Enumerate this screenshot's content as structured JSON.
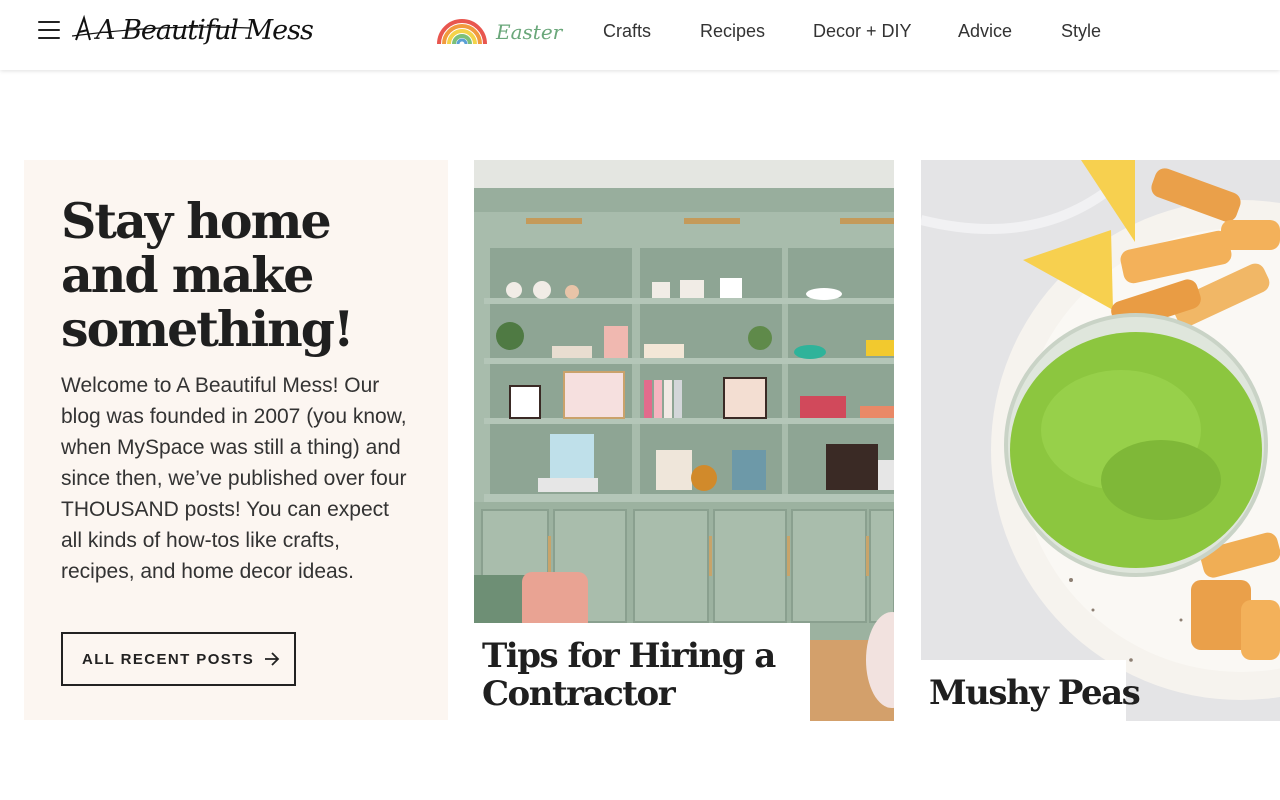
{
  "header": {
    "logo_text": "A Beautiful Mess",
    "promo_label": "Easter",
    "nav": [
      "Crafts",
      "Recipes",
      "Decor + DIY",
      "Advice",
      "Style"
    ]
  },
  "intro": {
    "heading": "Stay home and make something!",
    "body": "Welcome to A Beautiful Mess! Our blog was founded in 2007 (you know, when MySpace was still a thing) and since then, we’ve published over four THOUSAND posts! You can expect all kinds of how-tos like crafts, recipes, and home decor ideas.",
    "cta_label": "ALL RECENT POSTS"
  },
  "posts": [
    {
      "title": "Tips for Hiring a Contractor"
    },
    {
      "title": "Mushy Peas"
    }
  ],
  "colors": {
    "intro_bg": "#fcf6f1",
    "shelf_green": "#9fb5a5",
    "easter_green": "#6aa77a",
    "pea_green": "#8cc63f"
  },
  "icons": [
    "menu-icon",
    "rainbow-icon",
    "arrow-right-icon"
  ]
}
